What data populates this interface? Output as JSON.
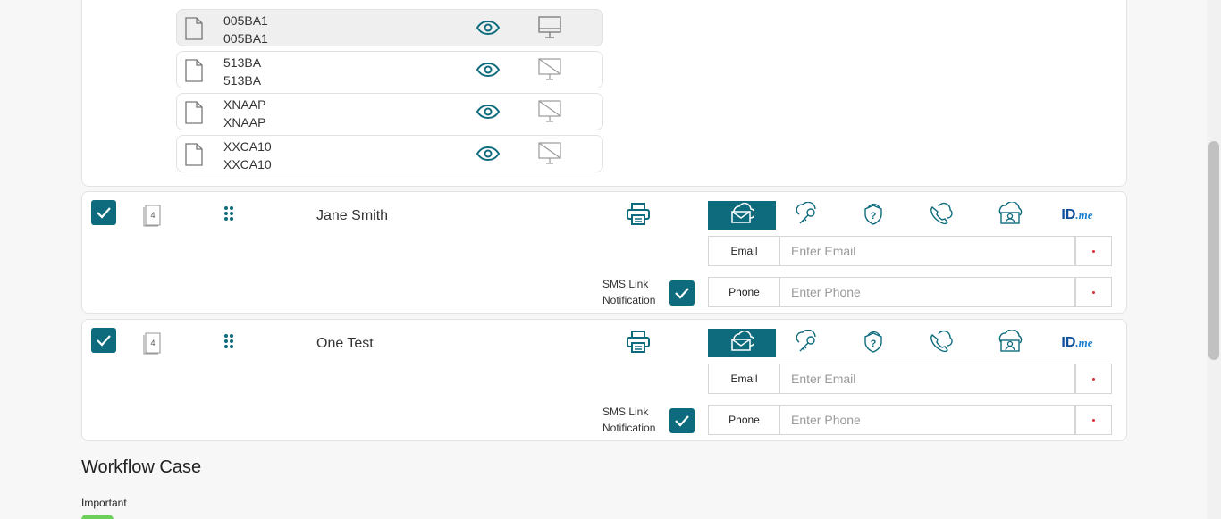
{
  "documents": [
    {
      "line1": "005BA1",
      "line2": "005BA1",
      "selected": true,
      "display": "monitor-icon"
    },
    {
      "line1": "513BA",
      "line2": "513BA",
      "selected": false,
      "display": "monitor-off-icon"
    },
    {
      "line1": "XNAAP",
      "line2": "XNAAP",
      "selected": false,
      "display": "monitor-off-icon"
    },
    {
      "line1": "XXCA10",
      "line2": "XXCA10",
      "selected": false,
      "display": "monitor-off-icon"
    }
  ],
  "signers": [
    {
      "name": "Jane Smith",
      "page_count": "4",
      "email_label": "Email",
      "email_placeholder": "Enter Email",
      "phone_label": "Phone",
      "phone_placeholder": "Enter Phone",
      "sms_line1": "SMS Link",
      "sms_line2": "Notification"
    },
    {
      "name": "One Test",
      "page_count": "4",
      "email_label": "Email",
      "email_placeholder": "Enter Email",
      "phone_label": "Phone",
      "phone_placeholder": "Enter Phone",
      "sms_line1": "SMS Link",
      "sms_line2": "Notification"
    }
  ],
  "auth_methods": [
    "email-auth-icon",
    "cloud-key-icon",
    "shield-question-icon",
    "cloud-phone-icon",
    "cloud-id-icon",
    "idme-logo"
  ],
  "idme_logo": {
    "id": "ID",
    "me": ".me"
  },
  "workflow": {
    "title": "Workflow Case",
    "important_label": "Important"
  },
  "colors": {
    "accent": "#0e6b7d",
    "idme": "#0e4f9c",
    "toggle_on": "#6ccf5a",
    "required_dot": "#e0303a"
  }
}
